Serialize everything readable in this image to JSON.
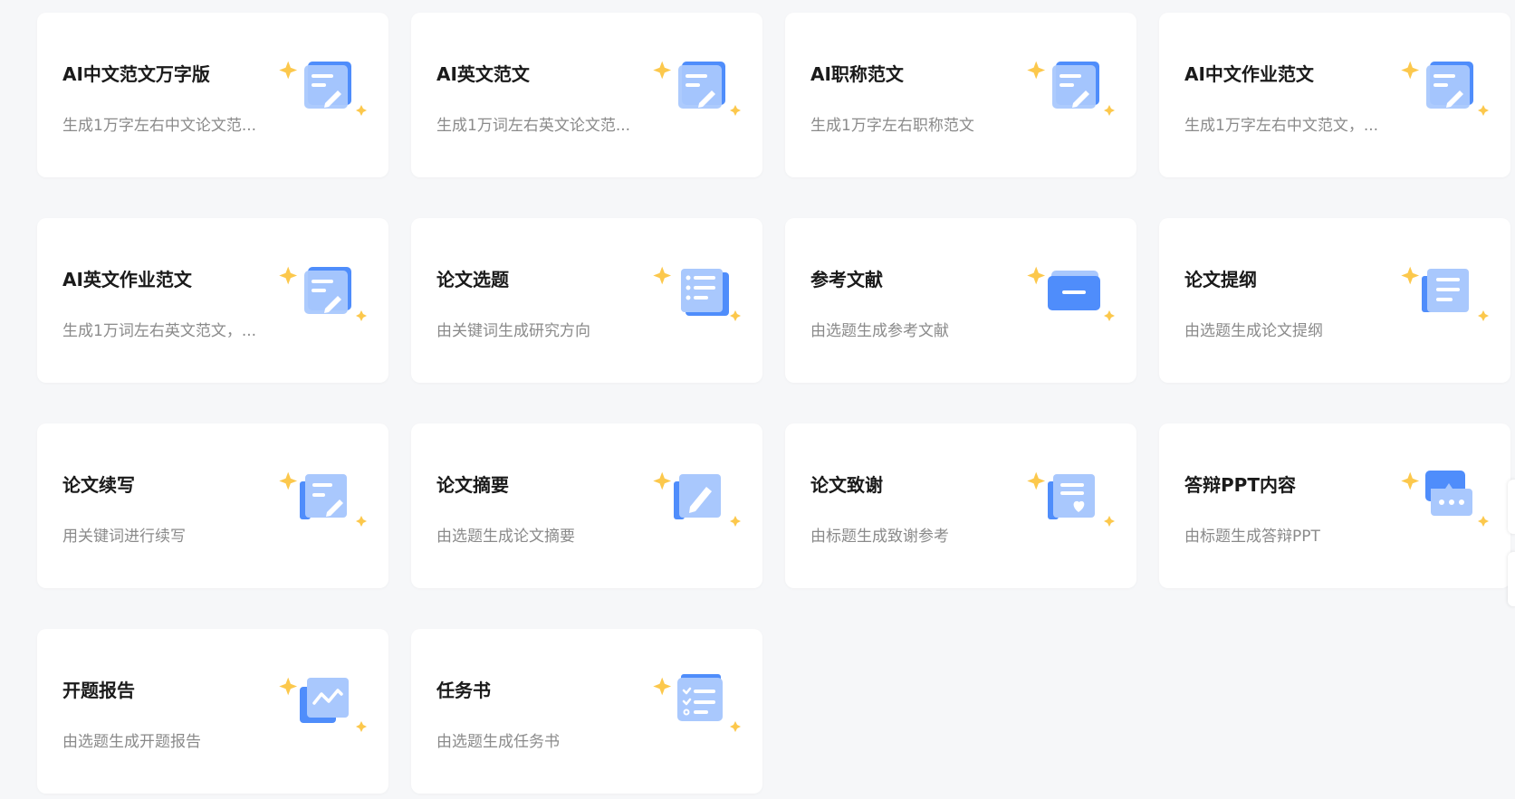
{
  "cards": [
    {
      "title": "AI中文范文万字版",
      "desc": "生成1万字左右中文论文范...",
      "icon": "document-pen-icon"
    },
    {
      "title": "AI英文范文",
      "desc": "生成1万词左右英文论文范...",
      "icon": "document-pen-icon"
    },
    {
      "title": "AI职称范文",
      "desc": "生成1万字左右职称范文",
      "icon": "document-pen-icon"
    },
    {
      "title": "AI中文作业范文",
      "desc": "生成1万字左右中文范文，...",
      "icon": "document-pen-icon"
    },
    {
      "title": "AI英文作业范文",
      "desc": "生成1万词左右英文范文，...",
      "icon": "document-pen-icon"
    },
    {
      "title": "论文选题",
      "desc": "由关键词生成研究方向",
      "icon": "topic-list-icon"
    },
    {
      "title": "参考文献",
      "desc": "由选题生成参考文献",
      "icon": "folder-icon"
    },
    {
      "title": "论文提纲",
      "desc": "由选题生成论文提纲",
      "icon": "outline-icon"
    },
    {
      "title": "论文续写",
      "desc": "用关键词进行续写",
      "icon": "continue-writing-icon"
    },
    {
      "title": "论文摘要",
      "desc": "由选题生成论文摘要",
      "icon": "abstract-pen-icon"
    },
    {
      "title": "论文致谢",
      "desc": "由标题生成致谢参考",
      "icon": "heart-document-icon"
    },
    {
      "title": "答辩PPT内容",
      "desc": "由标题生成答辩PPT",
      "icon": "chat-bubble-icon"
    },
    {
      "title": "开题报告",
      "desc": "由选题生成开题报告",
      "icon": "chart-report-icon"
    },
    {
      "title": "任务书",
      "desc": "由选题生成任务书",
      "icon": "checklist-icon"
    }
  ],
  "colors": {
    "background": "#f6f7f9",
    "card": "#ffffff",
    "title": "#1a1a1a",
    "desc": "#8a8a8a",
    "icon_blue": "#4f8dfb",
    "icon_light": "#a9c8fd",
    "sparkle": "#fcc84c"
  }
}
